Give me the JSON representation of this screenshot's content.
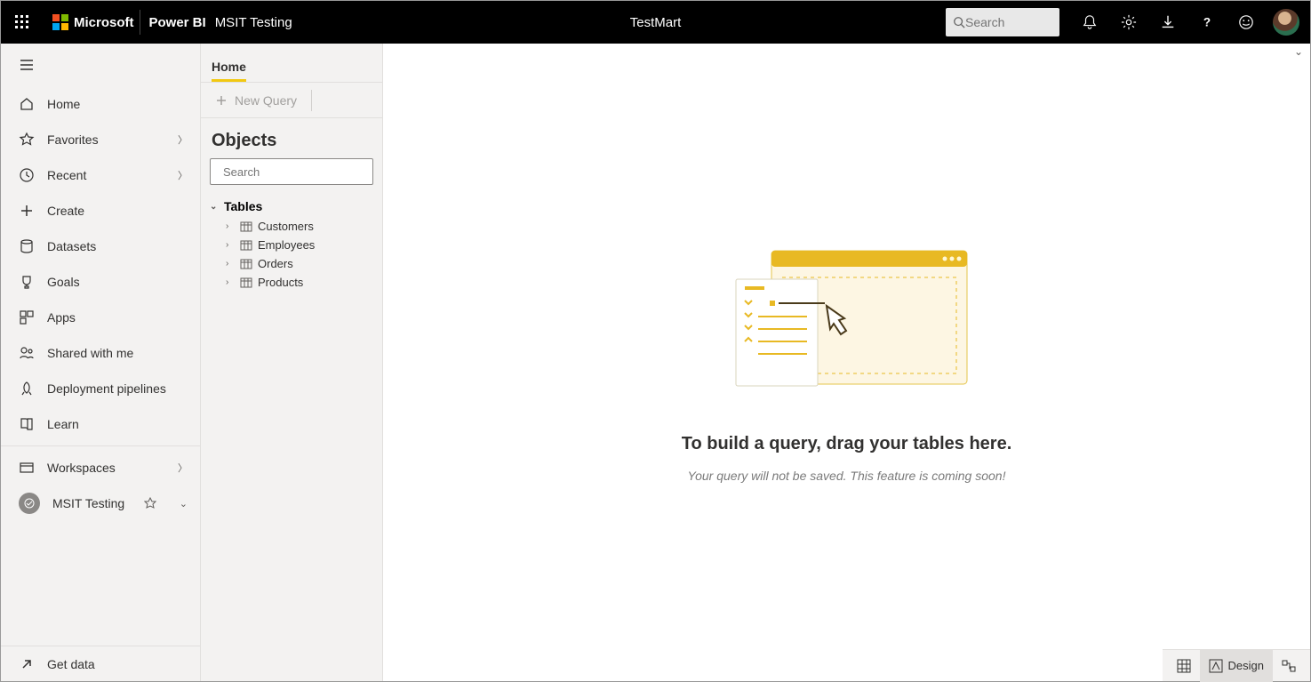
{
  "topbar": {
    "ms": "Microsoft",
    "product": "Power BI",
    "workspace": "MSIT Testing",
    "center_title": "TestMart",
    "search_placeholder": "Search"
  },
  "leftnav": {
    "home": "Home",
    "favorites": "Favorites",
    "recent": "Recent",
    "create": "Create",
    "datasets": "Datasets",
    "goals": "Goals",
    "apps": "Apps",
    "shared": "Shared with me",
    "pipelines": "Deployment pipelines",
    "learn": "Learn",
    "workspaces": "Workspaces",
    "current_workspace": "MSIT Testing",
    "get_data": "Get data"
  },
  "objects": {
    "tab_home": "Home",
    "new_query": "New Query",
    "header": "Objects",
    "search_placeholder": "Search",
    "tables_label": "Tables",
    "tables": [
      "Customers",
      "Employees",
      "Orders",
      "Products"
    ]
  },
  "canvas": {
    "empty_title": "To build a query, drag your tables here.",
    "empty_sub": "Your query will not be saved. This feature is coming soon!"
  },
  "statusbar": {
    "design": "Design"
  }
}
